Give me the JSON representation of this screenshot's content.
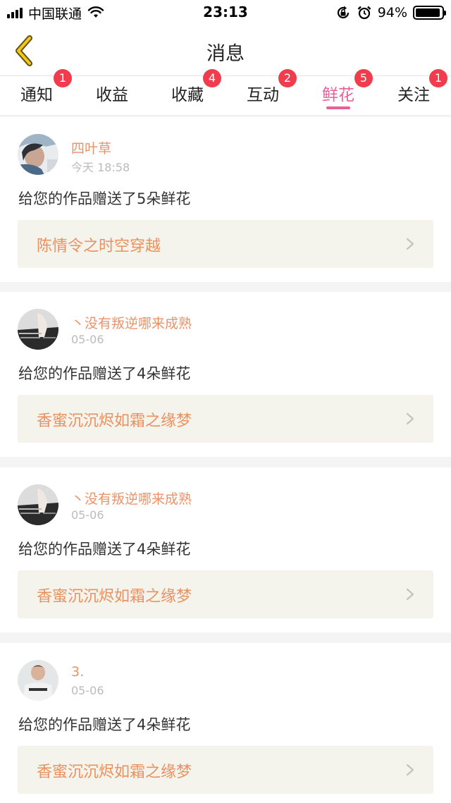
{
  "status_bar": {
    "carrier": "中国联通",
    "time": "23:13",
    "battery_percent": "94%",
    "battery_level": 0.94
  },
  "nav": {
    "title": "消息"
  },
  "tabs": [
    {
      "label": "通知",
      "badge": "1"
    },
    {
      "label": "收益",
      "badge": ""
    },
    {
      "label": "收藏",
      "badge": "4"
    },
    {
      "label": "互动",
      "badge": "2"
    },
    {
      "label": "鲜花",
      "badge": "5",
      "active": true
    },
    {
      "label": "关注",
      "badge": "1"
    }
  ],
  "messages": [
    {
      "user": "四叶草",
      "time": "今天 18:58",
      "text": "给您的作品赠送了5朵鲜花",
      "work": "陈情令之时空穿越",
      "avatar_icon": "avatar-photo-icon"
    },
    {
      "user": "丶没有叛逆哪来成熟",
      "time": "05-06",
      "text": "给您的作品赠送了4朵鲜花",
      "work": "香蜜沉沉烬如霜之缘梦",
      "avatar_icon": "avatar-photo-icon"
    },
    {
      "user": "丶没有叛逆哪来成熟",
      "time": "05-06",
      "text": "给您的作品赠送了4朵鲜花",
      "work": "香蜜沉沉烬如霜之缘梦",
      "avatar_icon": "avatar-photo-icon"
    },
    {
      "user": "3.",
      "time": "05-06",
      "text": "给您的作品赠送了4朵鲜花",
      "work": "香蜜沉沉烬如霜之缘梦",
      "avatar_icon": "avatar-photo-icon"
    }
  ],
  "colors": {
    "accent": "#e8609a",
    "badge": "#f03c4c",
    "username": "#e9936a",
    "work_title": "#ea9160",
    "work_bg": "#f5f4ec"
  }
}
